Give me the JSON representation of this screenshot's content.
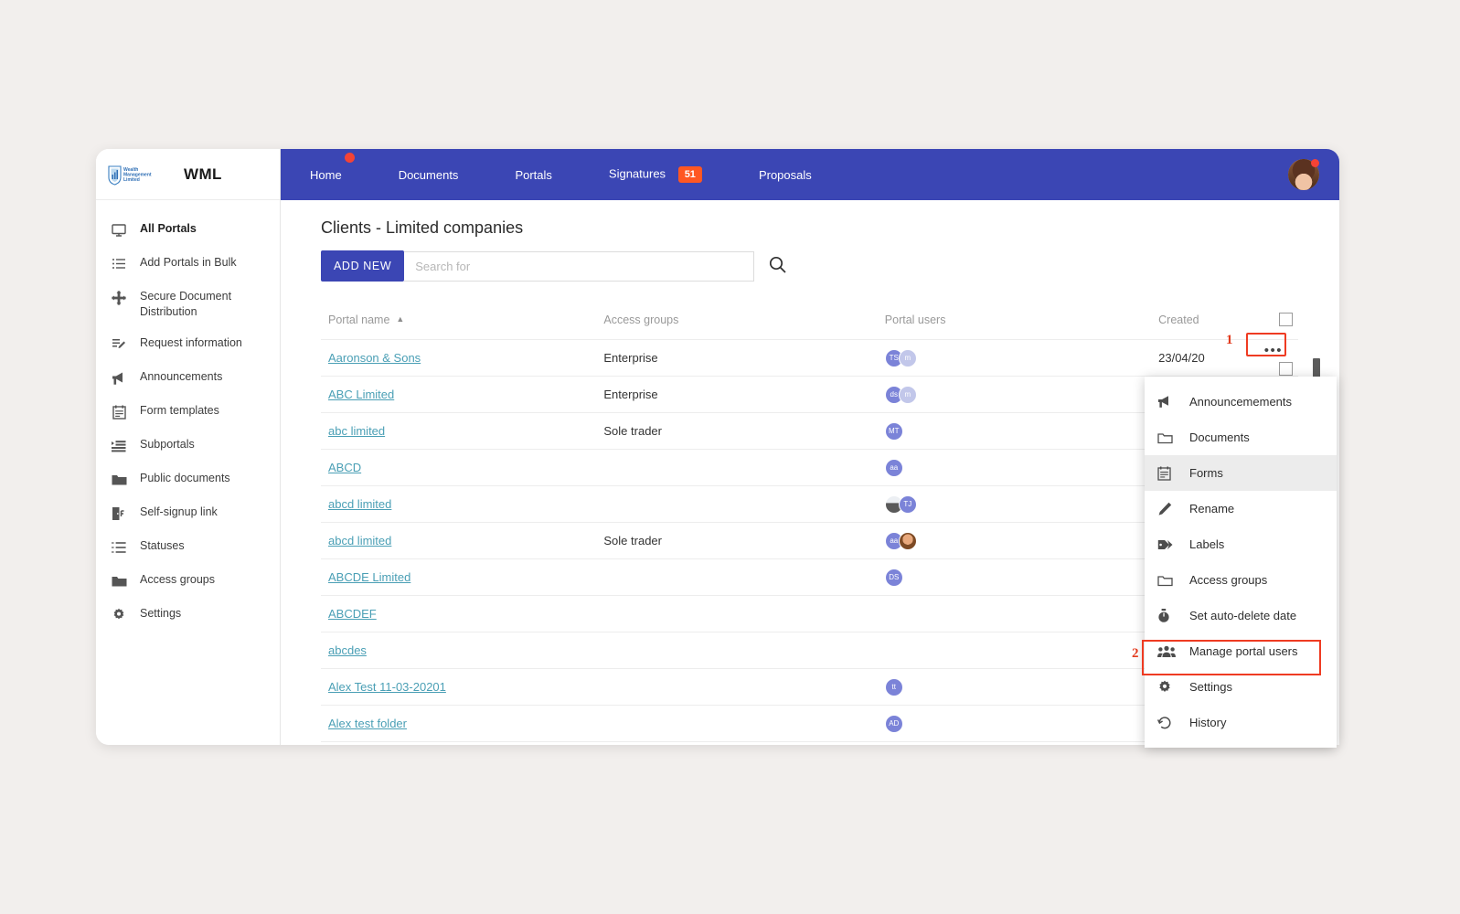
{
  "brand": {
    "logo_line1": "Wealth",
    "logo_line2": "Management",
    "logo_line3": "Limited",
    "short_name": "WML"
  },
  "topnav": {
    "items": [
      {
        "label": "Home",
        "badge_dot": true
      },
      {
        "label": "Documents"
      },
      {
        "label": "Portals"
      },
      {
        "label": "Signatures",
        "badge_count": "51"
      },
      {
        "label": "Proposals"
      }
    ]
  },
  "sidebar": {
    "items": [
      {
        "label": "All Portals",
        "icon": "monitor-icon",
        "active": true
      },
      {
        "label": "Add Portals in Bulk",
        "icon": "list-icon"
      },
      {
        "label": "Secure Document Distribution",
        "icon": "move-icon"
      },
      {
        "label": "Request information",
        "icon": "request-icon"
      },
      {
        "label": "Announcements",
        "icon": "megaphone-icon"
      },
      {
        "label": "Form templates",
        "icon": "form-icon"
      },
      {
        "label": "Subportals",
        "icon": "subportal-icon"
      },
      {
        "label": "Public documents",
        "icon": "folder-icon"
      },
      {
        "label": "Self-signup link",
        "icon": "door-icon"
      },
      {
        "label": "Statuses",
        "icon": "status-list-icon"
      },
      {
        "label": "Access groups",
        "icon": "folder-icon"
      },
      {
        "label": "Settings",
        "icon": "gear-icon"
      }
    ]
  },
  "main": {
    "page_title": "Clients - Limited companies",
    "add_new_label": "ADD NEW",
    "search_placeholder": "Search for",
    "search_value": ""
  },
  "table": {
    "columns": [
      "Portal name",
      "Access groups",
      "Portal users",
      "Created",
      ""
    ],
    "sort_column": "Portal name",
    "sort_direction": "asc",
    "rows": [
      {
        "name": "Aaronson & Sons",
        "access_group": "Enterprise",
        "users": [
          {
            "initials": "TS",
            "style": "solid"
          },
          {
            "initials": "m",
            "style": "light"
          }
        ],
        "created": "23/04/20"
      },
      {
        "name": "ABC Limited",
        "access_group": "Enterprise",
        "users": [
          {
            "initials": "ds",
            "style": "solid"
          },
          {
            "initials": "m",
            "style": "light"
          }
        ],
        "created": ""
      },
      {
        "name": "abc limited",
        "access_group": "Sole trader",
        "users": [
          {
            "initials": "MT",
            "style": "solid"
          }
        ],
        "created": ""
      },
      {
        "name": "ABCD",
        "access_group": "",
        "users": [
          {
            "initials": "aa",
            "style": "solid"
          }
        ],
        "created": ""
      },
      {
        "name": "abcd limited",
        "access_group": "",
        "users": [
          {
            "initials": "",
            "style": "photo-a"
          },
          {
            "initials": "TJ",
            "style": "solid"
          }
        ],
        "created": ""
      },
      {
        "name": "abcd limited",
        "access_group": "Sole trader",
        "users": [
          {
            "initials": "aa",
            "style": "solid"
          },
          {
            "initials": "",
            "style": "photo-b"
          }
        ],
        "created": ""
      },
      {
        "name": "ABCDE Limited",
        "access_group": "",
        "users": [
          {
            "initials": "DS",
            "style": "solid"
          }
        ],
        "created": ""
      },
      {
        "name": "ABCDEF",
        "access_group": "",
        "users": [],
        "created": ""
      },
      {
        "name": "abcdes",
        "access_group": "",
        "users": [],
        "created": ""
      },
      {
        "name": "Alex Test 11-03-20201",
        "access_group": "",
        "users": [
          {
            "initials": "tt",
            "style": "solid"
          }
        ],
        "created": ""
      },
      {
        "name": "Alex test folder",
        "access_group": "",
        "users": [
          {
            "initials": "AD",
            "style": "solid"
          }
        ],
        "created": ""
      }
    ]
  },
  "context_menu": {
    "items": [
      {
        "label": "Announcemements",
        "icon": "megaphone-icon"
      },
      {
        "label": "Documents",
        "icon": "folder-icon"
      },
      {
        "label": "Forms",
        "icon": "form-icon",
        "hovered": true
      },
      {
        "label": "Rename",
        "icon": "pencil-icon"
      },
      {
        "label": "Labels",
        "icon": "tag-icon"
      },
      {
        "label": "Access groups",
        "icon": "folder-icon"
      },
      {
        "label": "Set auto-delete date",
        "icon": "timer-icon"
      },
      {
        "label": "Manage portal users",
        "icon": "users-icon",
        "highlighted": true
      },
      {
        "label": "Settings",
        "icon": "gear-icon"
      },
      {
        "label": "History",
        "icon": "history-icon"
      }
    ]
  },
  "annotations": {
    "step1": "1",
    "step2": "2",
    "highlight_color": "#ef3b22"
  }
}
